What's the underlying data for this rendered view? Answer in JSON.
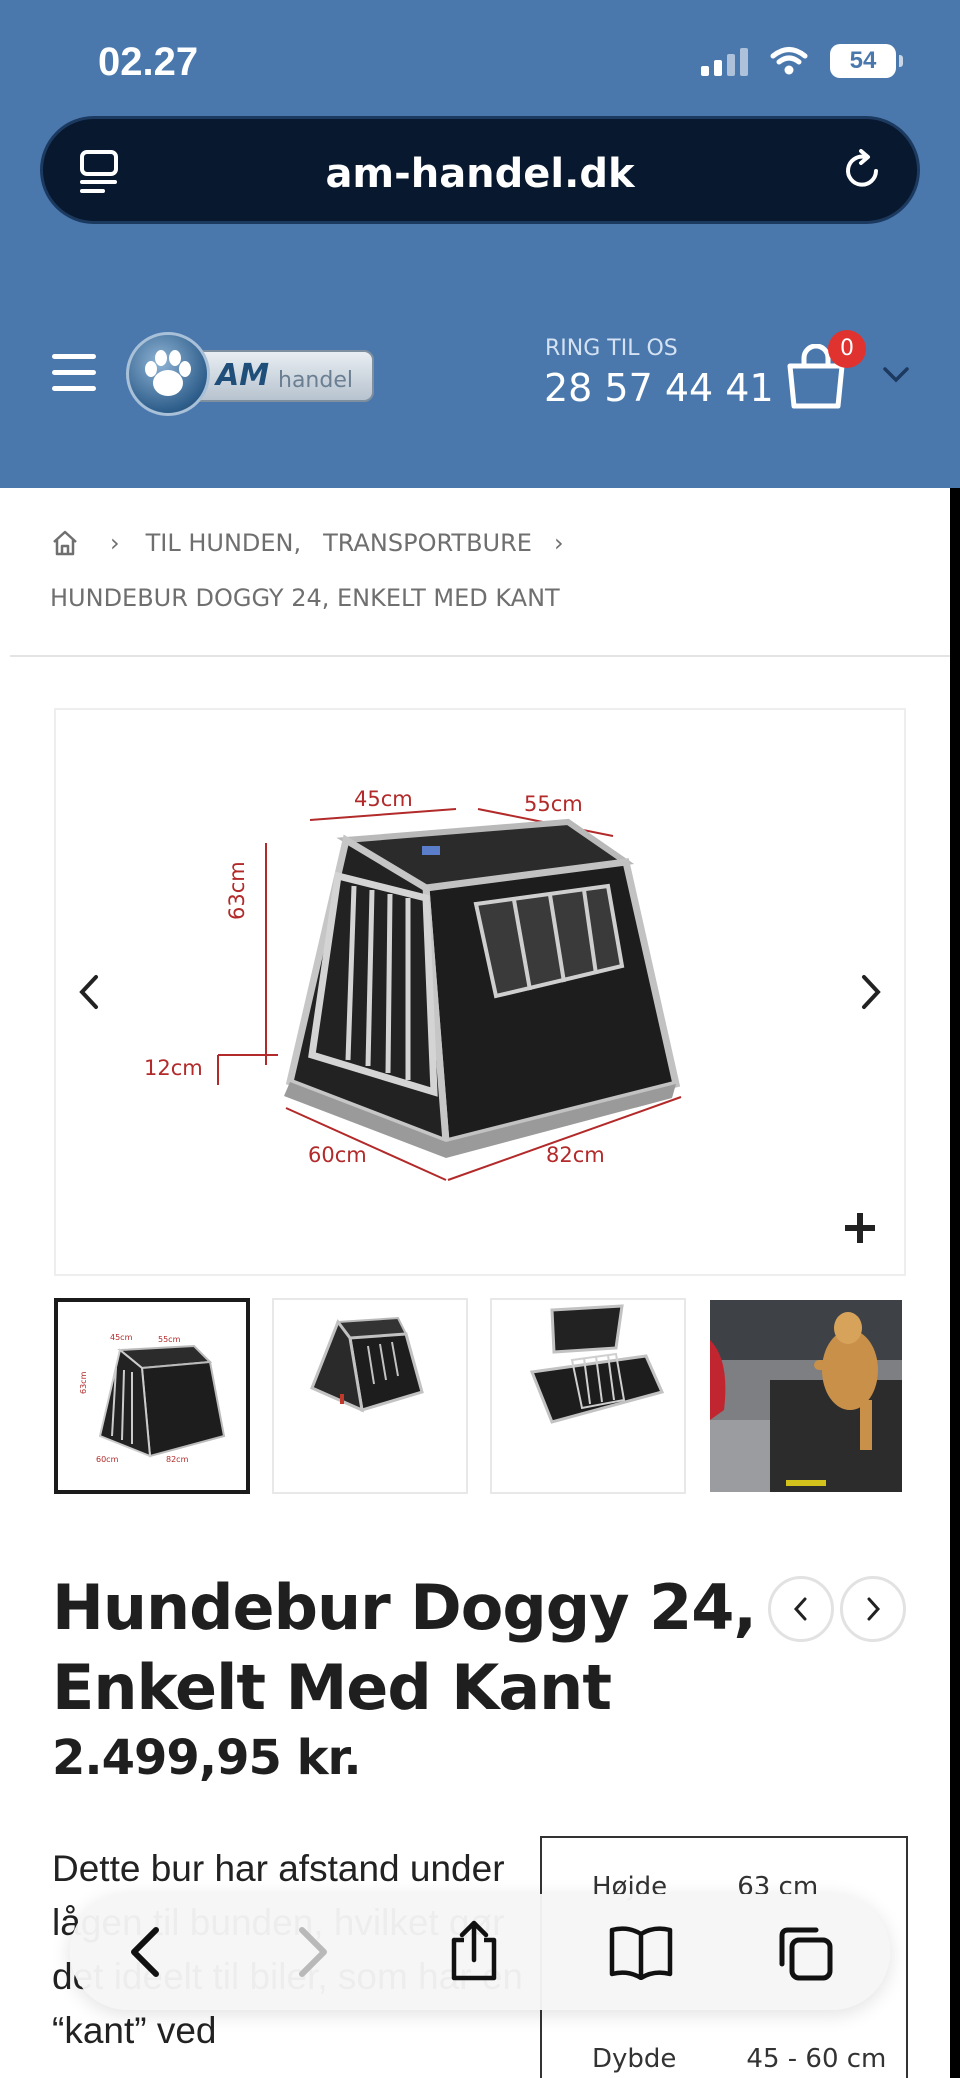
{
  "status_bar": {
    "time": "02.27",
    "battery": "54"
  },
  "browser": {
    "url": "am-handel.dk"
  },
  "header": {
    "logo_am": "AM",
    "logo_handel": "handel",
    "ring_label": "RING TIL OS",
    "phone": "28 57 44 41",
    "cart_count": "0"
  },
  "breadcrumb": {
    "items": [
      "TIL HUNDEN,",
      "TRANSPORTBURE"
    ],
    "current": "HUNDEBUR DOGGY 24, ENKELT MED KANT"
  },
  "gallery": {
    "dimensions": {
      "top_left": "45cm",
      "top_right": "55cm",
      "height": "63cm",
      "clearance": "12cm",
      "bottom_left": "60cm",
      "bottom_right": "82cm"
    },
    "thumb_labels": {
      "a": "45cm",
      "b": "55cm",
      "c": "63cm",
      "d": "60cm",
      "e": "82cm"
    }
  },
  "product": {
    "title": "Hundebur Doggy 24, Enkelt Med Kant",
    "price": "2.499,95 kr.",
    "description": "Dette bur har afstand under lågen til bunden, hvilket gør det ideelt til biler, som har en “kant” ved",
    "specs": [
      {
        "label": "Højde",
        "value": "63 cm"
      },
      {
        "label": "Dybde",
        "value": "45 - 60 cm"
      }
    ]
  },
  "colors": {
    "header": "#4a78ad",
    "urlbar": "#07182f",
    "badge": "#e0322e",
    "dim_text": "#b22a2a"
  }
}
